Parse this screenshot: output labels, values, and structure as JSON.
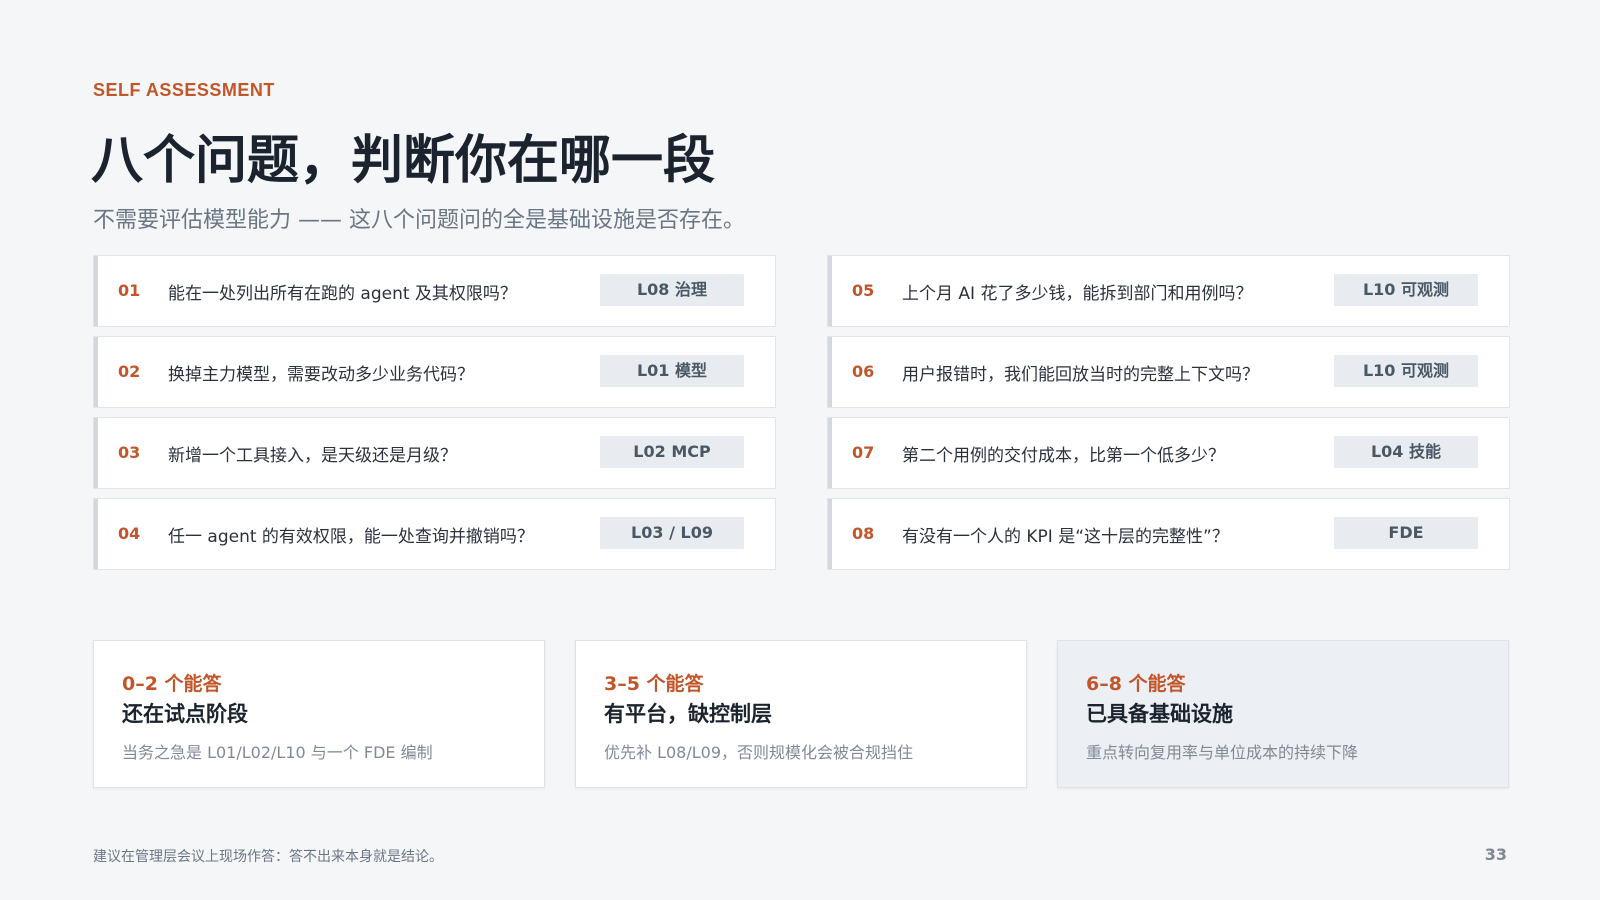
{
  "eyebrow": "SELF ASSESSMENT",
  "title": "八个问题，判断你在哪一段",
  "subtitle": "不需要评估模型能力 —— 这八个问题问的全是基础设施是否存在。",
  "questions": [
    {
      "num": "01",
      "text": "能在一处列出所有在跑的 agent 及其权限吗？",
      "tag": "L08 治理"
    },
    {
      "num": "02",
      "text": "换掉主力模型，需要改动多少业务代码？",
      "tag": "L01 模型"
    },
    {
      "num": "03",
      "text": "新增一个工具接入，是天级还是月级？",
      "tag": "L02 MCP"
    },
    {
      "num": "04",
      "text": "任一 agent 的有效权限，能一处查询并撤销吗？",
      "tag": "L03 / L09"
    },
    {
      "num": "05",
      "text": "上个月 AI 花了多少钱，能拆到部门和用例吗？",
      "tag": "L10 可观测"
    },
    {
      "num": "06",
      "text": "用户报错时，我们能回放当时的完整上下文吗？",
      "tag": "L10 可观测"
    },
    {
      "num": "07",
      "text": "第二个用例的交付成本，比第一个低多少？",
      "tag": "L04 技能"
    },
    {
      "num": "08",
      "text": "有没有一个人的 KPI 是“这十层的完整性”？",
      "tag": "FDE"
    }
  ],
  "results": [
    {
      "range": "0–2 个能答",
      "head": "还在试点阶段",
      "desc": "当务之急是 L01/L02/L10 与一个 FDE 编制"
    },
    {
      "range": "3–5 个能答",
      "head": "有平台，缺控制层",
      "desc": "优先补 L08/L09，否则规模化会被合规挡住"
    },
    {
      "range": "6–8 个能答",
      "head": "已具备基础设施",
      "desc": "重点转向复用率与单位成本的持续下降"
    }
  ],
  "footnote": "建议在管理层会议上现场作答：答不出来本身就是结论。",
  "page_number": "33"
}
